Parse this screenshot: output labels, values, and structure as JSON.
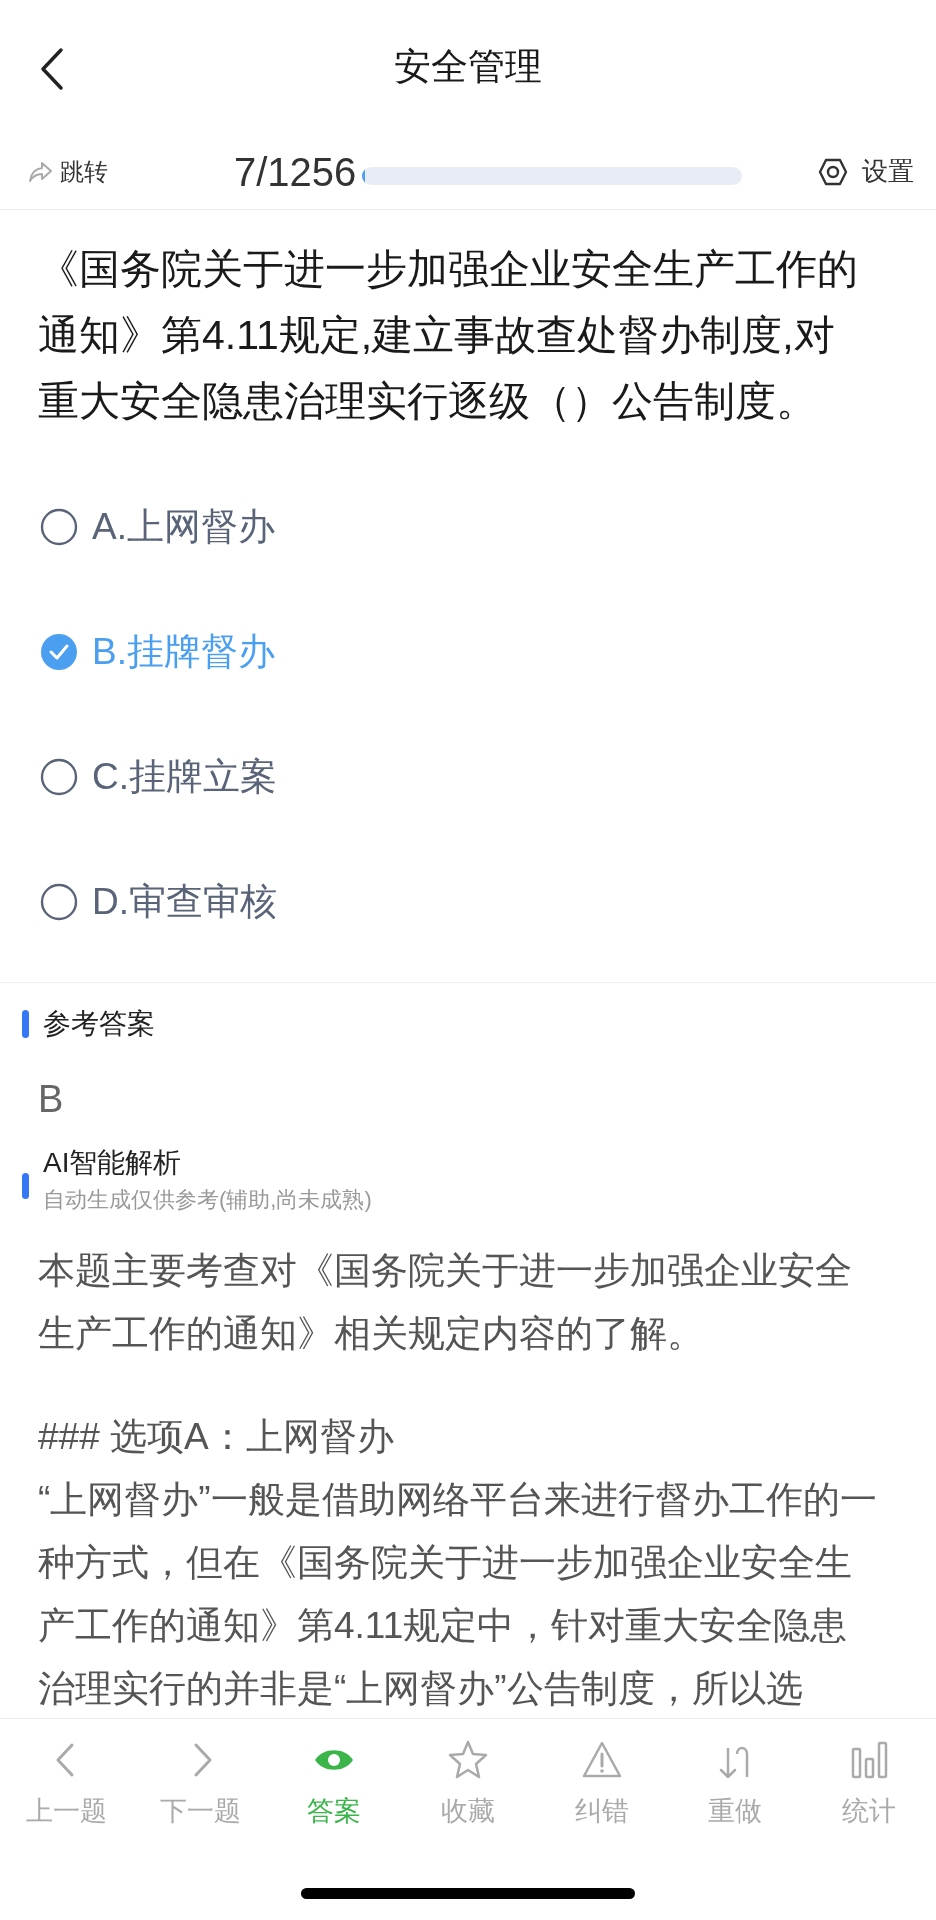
{
  "header": {
    "title": "安全管理"
  },
  "progress_row": {
    "jump_label": "跳转",
    "counter": "7/1256",
    "level": 0.006,
    "settings_label": "设置"
  },
  "question": {
    "text": "《国务院关于进一步加强企业安全生产工作的通知》第4.11规定,建立事故查处督办制度,对重大安全隐患治理实行逐级（）公告制度。",
    "options": [
      {
        "label": "A.上网督办",
        "selected": false
      },
      {
        "label": "B.挂牌督办",
        "selected": true
      },
      {
        "label": "C.挂牌立案",
        "selected": false
      },
      {
        "label": "D.审查审核",
        "selected": false
      }
    ]
  },
  "reference_answer": {
    "heading": "参考答案",
    "answer": "B"
  },
  "ai_analysis": {
    "heading": "AI智能解析",
    "subtitle": "自动生成仅供参考(辅助,尚未成熟)",
    "paragraphs": [
      "本题主要考查对《国务院关于进一步加强企业安全生产工作的通知》相关规定内容的了解。",
      "### 选项A：上网督办",
      "“上网督办”一般是借助网络平台来进行督办工作的一种方式，但在《国务院关于进一步加强企业安全生产工作的通知》第4.11规定中，针对重大安全隐患治理实行的并非是“上网督办”公告制度，所以选"
    ]
  },
  "bottom_nav": [
    {
      "kind": "prev",
      "label": "上一题",
      "selected": false
    },
    {
      "kind": "next",
      "label": "下一题",
      "selected": false
    },
    {
      "kind": "answer",
      "label": "答案",
      "selected": true
    },
    {
      "kind": "favorite",
      "label": "收藏",
      "selected": false
    },
    {
      "kind": "report",
      "label": "纠错",
      "selected": false
    },
    {
      "kind": "redo",
      "label": "重做",
      "selected": false
    },
    {
      "kind": "stats",
      "label": "统计",
      "selected": false
    }
  ]
}
